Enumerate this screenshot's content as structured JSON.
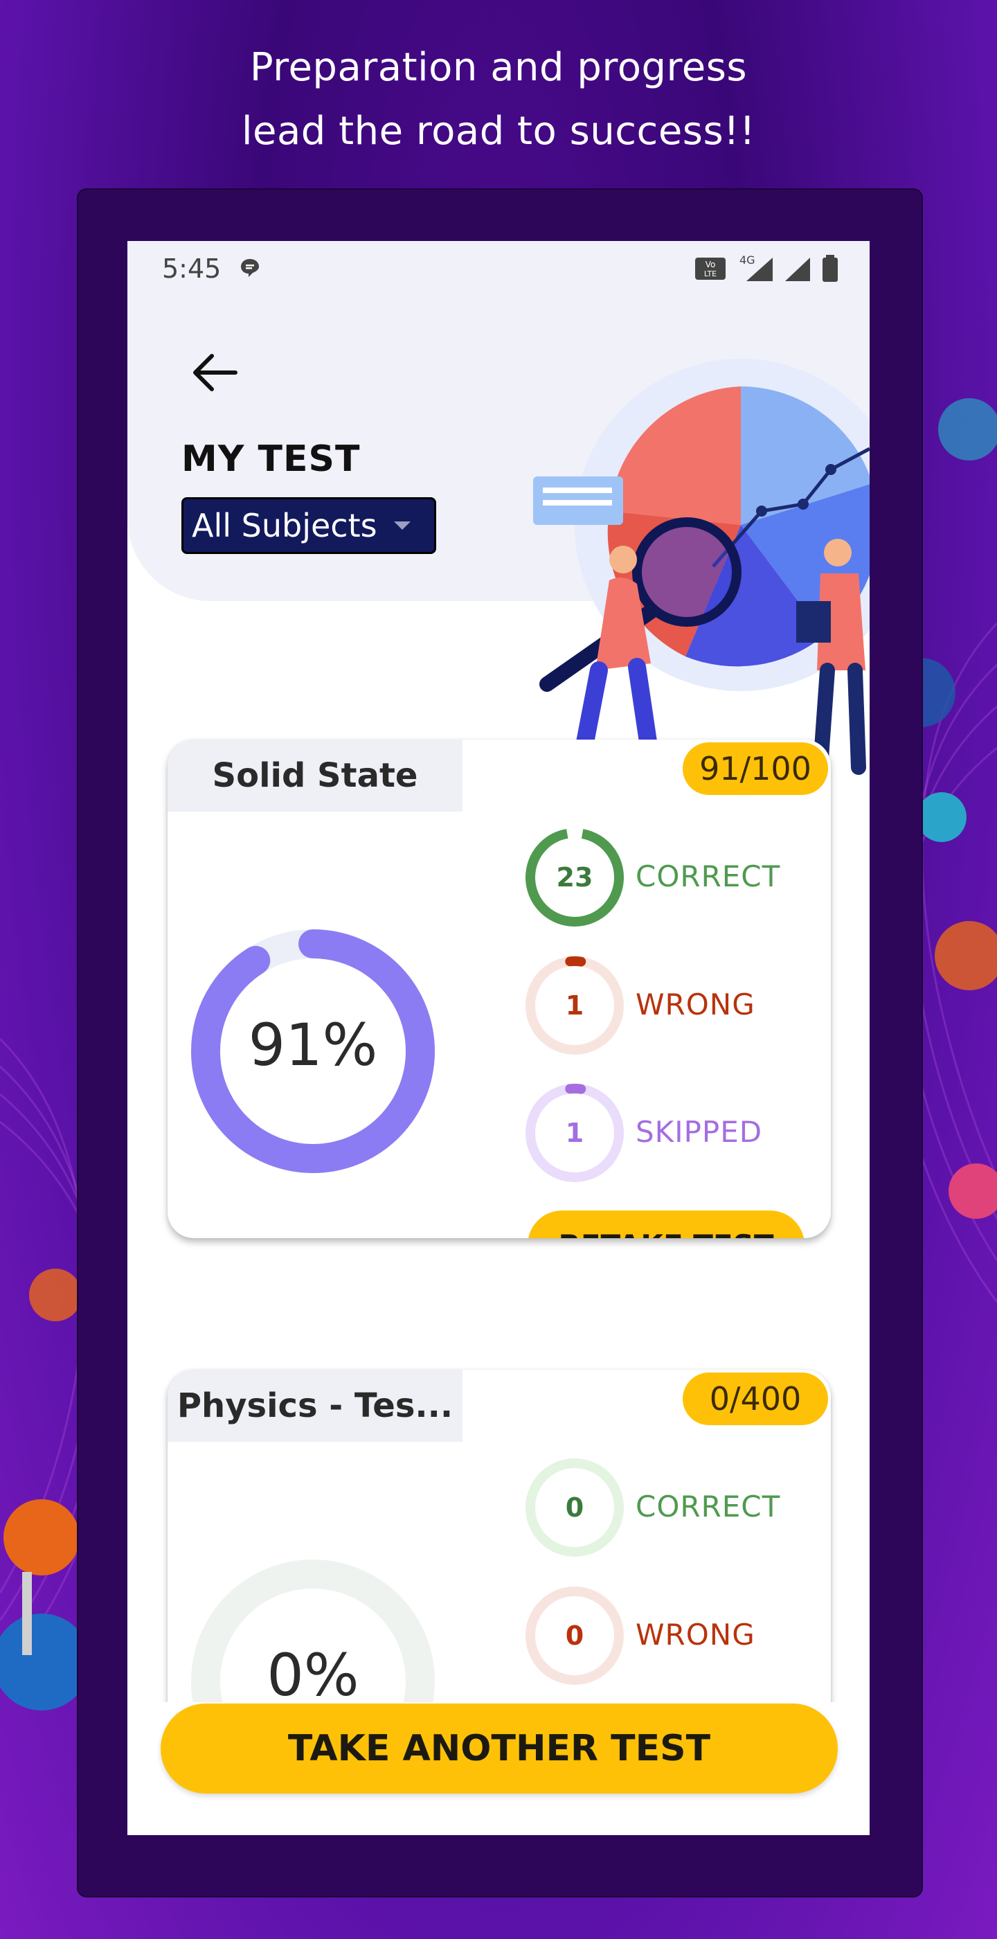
{
  "headline": {
    "line1": "Preparation and progress",
    "line2": "lead the road to success!!"
  },
  "status_bar": {
    "time": "5:45",
    "network": "4G"
  },
  "header": {
    "title": "MY TEST",
    "subject_filter": {
      "selected": "All Subjects"
    }
  },
  "tests": [
    {
      "name": "Solid State",
      "score": "91/100",
      "percent_label": "91%",
      "percent_value": 91,
      "correct": {
        "count": "23",
        "label": "CORRECT"
      },
      "wrong": {
        "count": "1",
        "label": "WRONG"
      },
      "skipped": {
        "count": "1",
        "label": "SKIPPED"
      },
      "retake_label": "RETAKE TEST"
    },
    {
      "name": "Physics - Tes...",
      "score": "0/400",
      "percent_label": "0%",
      "percent_value": 0,
      "correct": {
        "count": "0",
        "label": "CORRECT"
      },
      "wrong": {
        "count": "0",
        "label": "WRONG"
      }
    }
  ],
  "footer": {
    "take_another_label": "TAKE ANOTHER TEST"
  },
  "colors": {
    "accent_yellow": "#ffc107",
    "ring_purple": "#8b7cf3",
    "correct_green": "#4f9a4f",
    "wrong_red": "#b8330c",
    "skipped_purple": "#a46ee0",
    "select_navy": "#121a5c"
  },
  "icons": [
    "back-arrow-icon",
    "message-icon",
    "signal-icon",
    "battery-icon",
    "dropdown-caret-icon"
  ]
}
